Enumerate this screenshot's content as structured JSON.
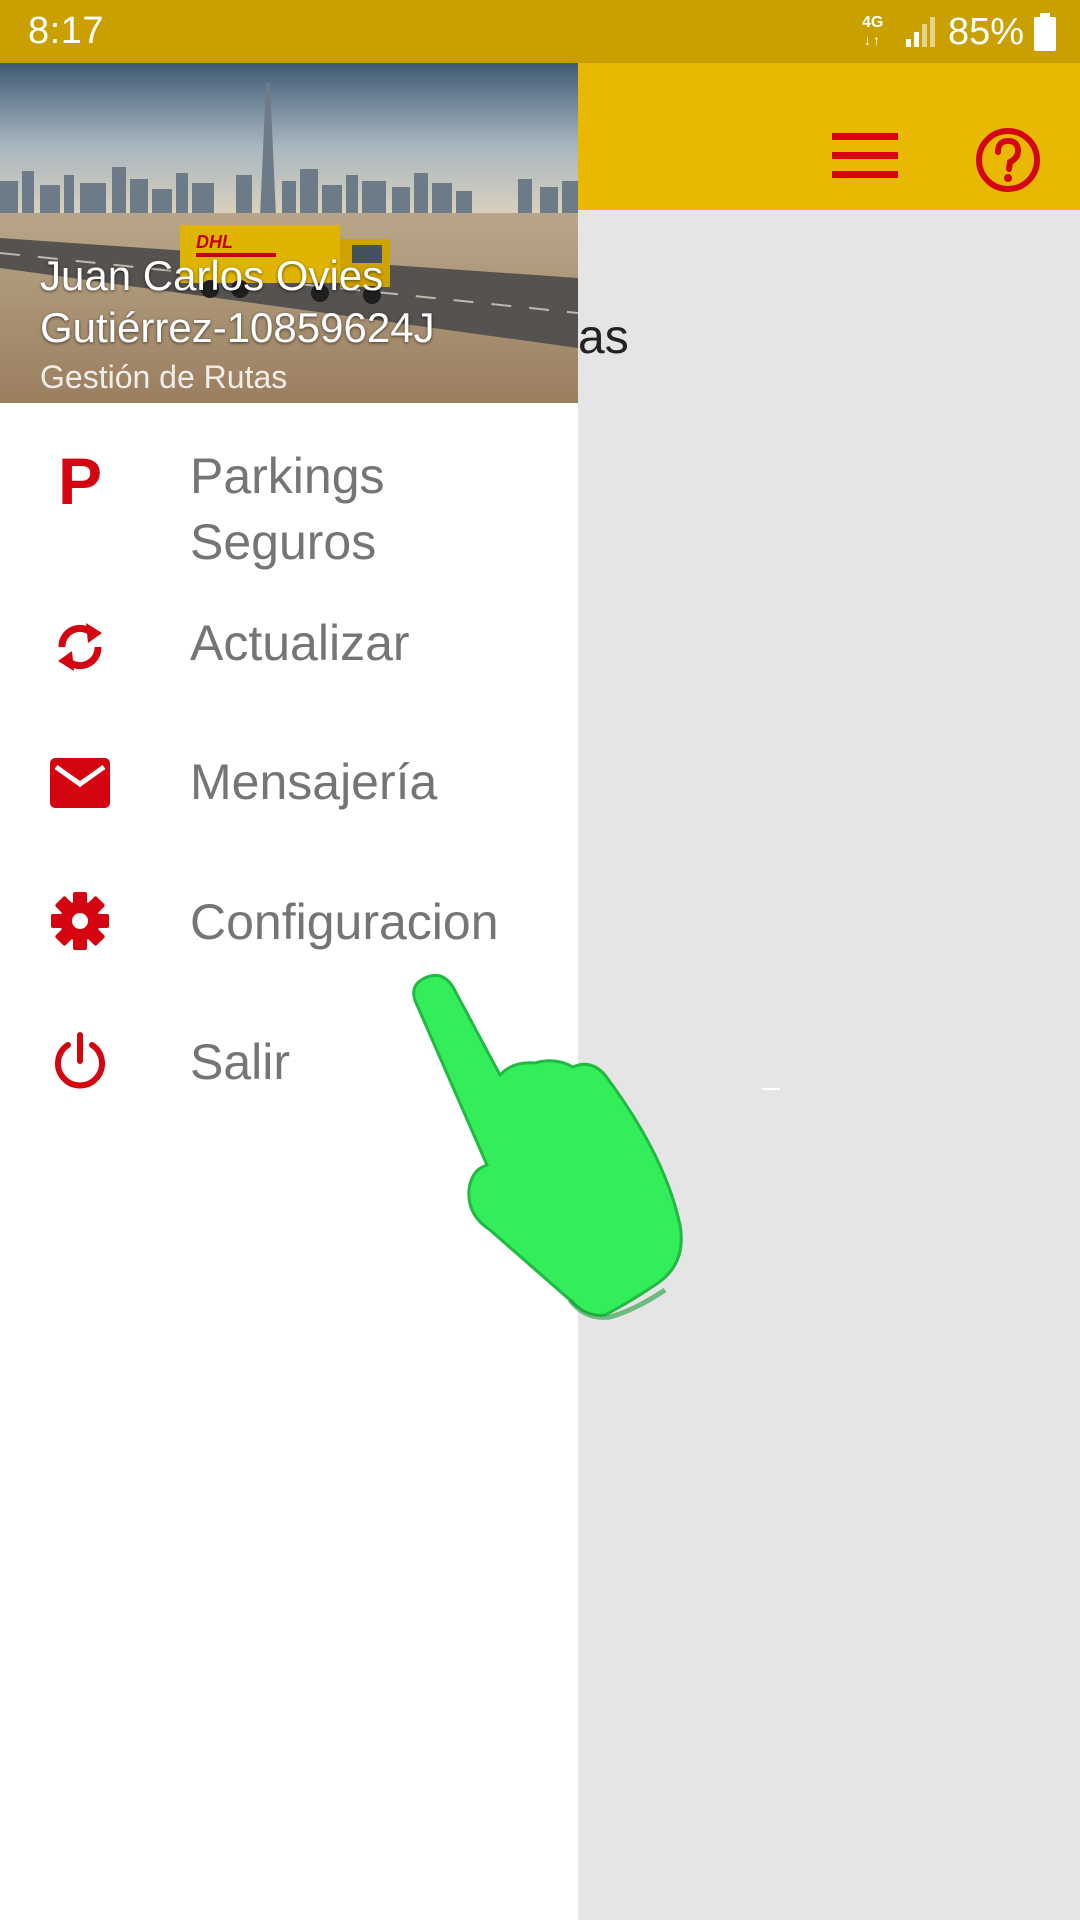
{
  "status_bar": {
    "time": "8:17",
    "network": "4G",
    "battery": "85%",
    "icons": [
      "network-4g-icon",
      "signal-icon",
      "battery-icon"
    ]
  },
  "app_bar": {
    "background_color": "#e8b900",
    "menu_icon": "hamburger-menu-icon",
    "help_icon": "help-circle-icon"
  },
  "background": {
    "title_fragment": "as"
  },
  "drawer": {
    "header": {
      "user_name": "Juan Carlos Ovies Gutiérrez-10859624J",
      "user_role": "Gestión de Rutas",
      "image_logo_text": "DHL"
    },
    "items": [
      {
        "label": "Parkings Seguros",
        "icon": "parking-icon",
        "icon_text": "P"
      },
      {
        "label": "Actualizar",
        "icon": "refresh-icon"
      },
      {
        "label": "Mensajería",
        "icon": "mail-icon"
      },
      {
        "label": "Configuracion",
        "icon": "settings-gear-icon"
      },
      {
        "label": "Salir",
        "icon": "power-icon"
      }
    ]
  },
  "colors": {
    "status_bar": "#c9a000",
    "accent_red": "#d40511",
    "drawer_text": "#757575",
    "hand_pointer": "#33ee5a"
  }
}
